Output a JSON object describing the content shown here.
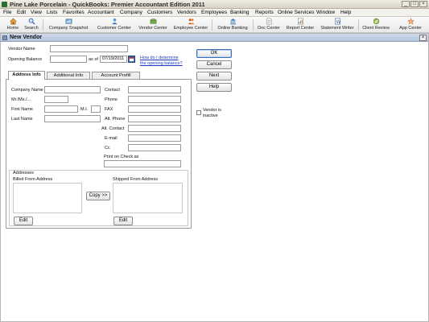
{
  "window": {
    "title": "Pine Lake Porcelain  - QuickBooks: Premier Accountant Edition 2011",
    "controls": [
      "_",
      "□",
      "×"
    ]
  },
  "menu": [
    "File",
    "Edit",
    "View",
    "Lists",
    "Favorites",
    "Accountant",
    "Company",
    "Customers",
    "Vendors",
    "Employees",
    "Banking",
    "Reports",
    "Online Services",
    "Window",
    "Help"
  ],
  "toolbar": {
    "home": "Home",
    "search": "Search",
    "company_snapshot": "Company Snapshot",
    "customer_center": "Customer Center",
    "vendor_center": "Vendor Center",
    "employee_center": "Employee Center",
    "online_banking": "Online Banking",
    "doc_center": "Doc Center",
    "report_center": "Report Center",
    "statement_writer": "Statement Writer",
    "client_review": "Client Review",
    "app_center": "App Center"
  },
  "dialog": {
    "title": "New Vendor",
    "close": "×",
    "vendor_name_label": "Vendor Name",
    "vendor_name_value": "",
    "opening_balance_label": "Opening Balance",
    "opening_balance_value": "",
    "as_of_label": "as of",
    "as_of_date": "07/19/2011",
    "help_link": "How do I determine the opening balance?",
    "help_link_line1": "How do I determine",
    "help_link_line2": "the opening balance?",
    "buttons": {
      "ok": "OK",
      "cancel": "Cancel",
      "next": "Next",
      "help": "Help"
    },
    "vendor_inactive_line1": "Vendor is",
    "vendor_inactive_line2": "inactive",
    "tabs": [
      "Address Info",
      "Additional Info",
      "Account Prefill"
    ],
    "fields": {
      "company_name": "Company Name",
      "mr_ms": "Mr./Ms./...",
      "first_name": "First Name",
      "mi": "M.I.",
      "last_name": "Last Name",
      "contact": "Contact",
      "phone": "Phone",
      "fax": "FAX",
      "alt_phone": "Alt. Phone",
      "alt_contact": "Alt. Contact",
      "email": "E-mail",
      "cc": "Cc",
      "print_on_check": "Print on Check as"
    },
    "addresses": {
      "group_label": "Addresses",
      "billed_from": "Billed From Address",
      "shipped_from": "Shipped From Address",
      "copy": "Copy >>",
      "edit": "Edit"
    }
  },
  "colors": {
    "title_bar": "#d8d2c4",
    "dialog_title": "#b5c4dc",
    "link": "#1a3fb8",
    "logo_green": "#2a6f2f"
  },
  "icons": {
    "home": "home-icon",
    "search": "search-icon",
    "company_snapshot": "snapshot-icon",
    "customer_center": "customer-center-icon",
    "vendor_center": "vendor-center-icon",
    "employee_center": "employee-center-icon",
    "online_banking": "online-banking-icon",
    "doc_center": "doc-center-icon",
    "report_center": "report-center-icon",
    "statement_writer": "statement-writer-icon",
    "client_review": "client-review-icon",
    "app_center": "app-center-icon",
    "calendar": "calendar-icon"
  }
}
